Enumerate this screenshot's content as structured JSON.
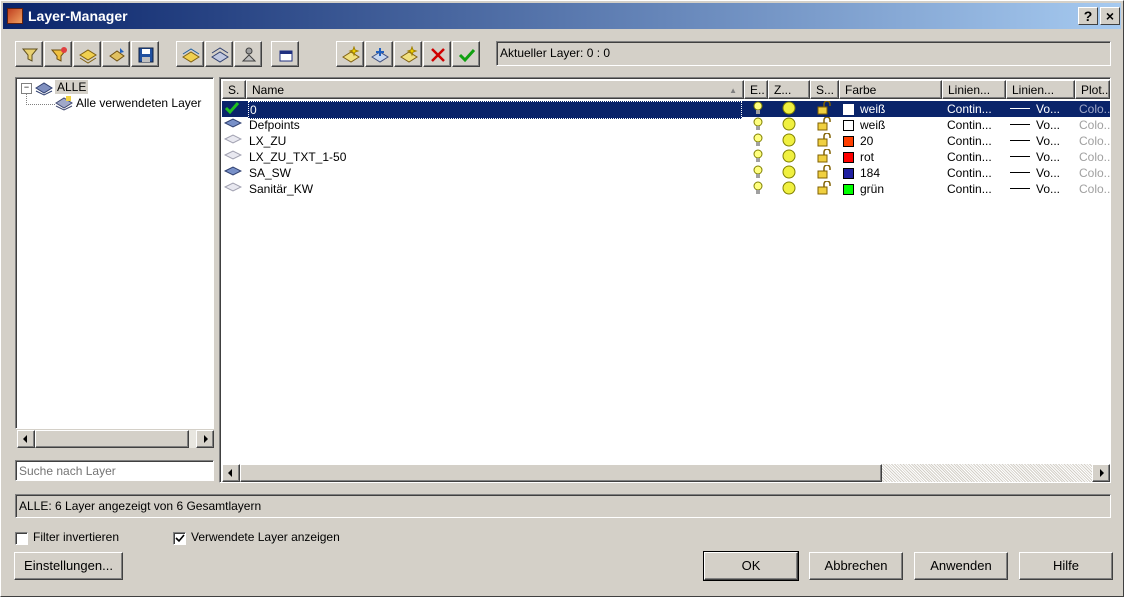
{
  "window": {
    "title": "Layer-Manager",
    "help_button": "?",
    "close_button": "×"
  },
  "current_layer": "Aktueller Layer: 0 : 0",
  "tree": {
    "root": "ALLE",
    "child": "Alle verwendeten Layer"
  },
  "search": {
    "placeholder": "Suche nach Layer"
  },
  "columns": [
    "S.",
    "Name",
    "E..",
    "Z...",
    "S...",
    "Farbe",
    "Linien...",
    "Linien...",
    "Plot..."
  ],
  "rows": [
    {
      "name": "0",
      "color_name": "weiß",
      "color_hex": "#ffffff",
      "linetype": "Contin...",
      "lineweight": "Vo...",
      "plot": "Colo...",
      "current": true,
      "icon": "check-icon"
    },
    {
      "name": "Defpoints",
      "color_name": "weiß",
      "color_hex": "#ffffff",
      "linetype": "Contin...",
      "lineweight": "Vo...",
      "plot": "Colo...",
      "icon": "layers-used-icon"
    },
    {
      "name": "LX_ZU",
      "color_name": "20",
      "color_hex": "#ff3f00",
      "linetype": "Contin...",
      "lineweight": "Vo...",
      "plot": "Colo...",
      "icon": "layers-unused-icon"
    },
    {
      "name": "LX_ZU_TXT_1-50",
      "color_name": "rot",
      "color_hex": "#ff0000",
      "linetype": "Contin...",
      "lineweight": "Vo...",
      "plot": "Colo...",
      "icon": "layers-unused-icon"
    },
    {
      "name": "SA_SW",
      "color_name": "184",
      "color_hex": "#1f1fa0",
      "linetype": "Contin...",
      "lineweight": "Vo...",
      "plot": "Colo...",
      "icon": "layers-used-icon"
    },
    {
      "name": "Sanitär_KW",
      "color_name": "grün",
      "color_hex": "#00ff00",
      "linetype": "Contin...",
      "lineweight": "Vo...",
      "plot": "Colo...",
      "icon": "layers-unused-icon"
    }
  ],
  "status": "ALLE: 6 Layer angezeigt von 6 Gesamtlayern",
  "options": {
    "invert_filter": "Filter invertieren",
    "show_used": "Verwendete Layer anzeigen",
    "invert_checked": false,
    "show_used_checked": true
  },
  "buttons": {
    "settings": "Einstellungen...",
    "ok": "OK",
    "cancel": "Abbrechen",
    "apply": "Anwenden",
    "help": "Hilfe"
  },
  "toolbar_icons": [
    "new-properties-filter-icon",
    "new-group-filter-icon",
    "layer-states-icon",
    "layer-translate-icon",
    "save-icon",
    "isolate-layer-icon",
    "unisolate-layer-icon",
    "layer-walk-icon",
    "layer-window-icon",
    "new-layer-icon",
    "new-layer-vp-frozen-icon",
    "new-layer-from-template-icon",
    "delete-layer-icon",
    "set-current-icon"
  ]
}
